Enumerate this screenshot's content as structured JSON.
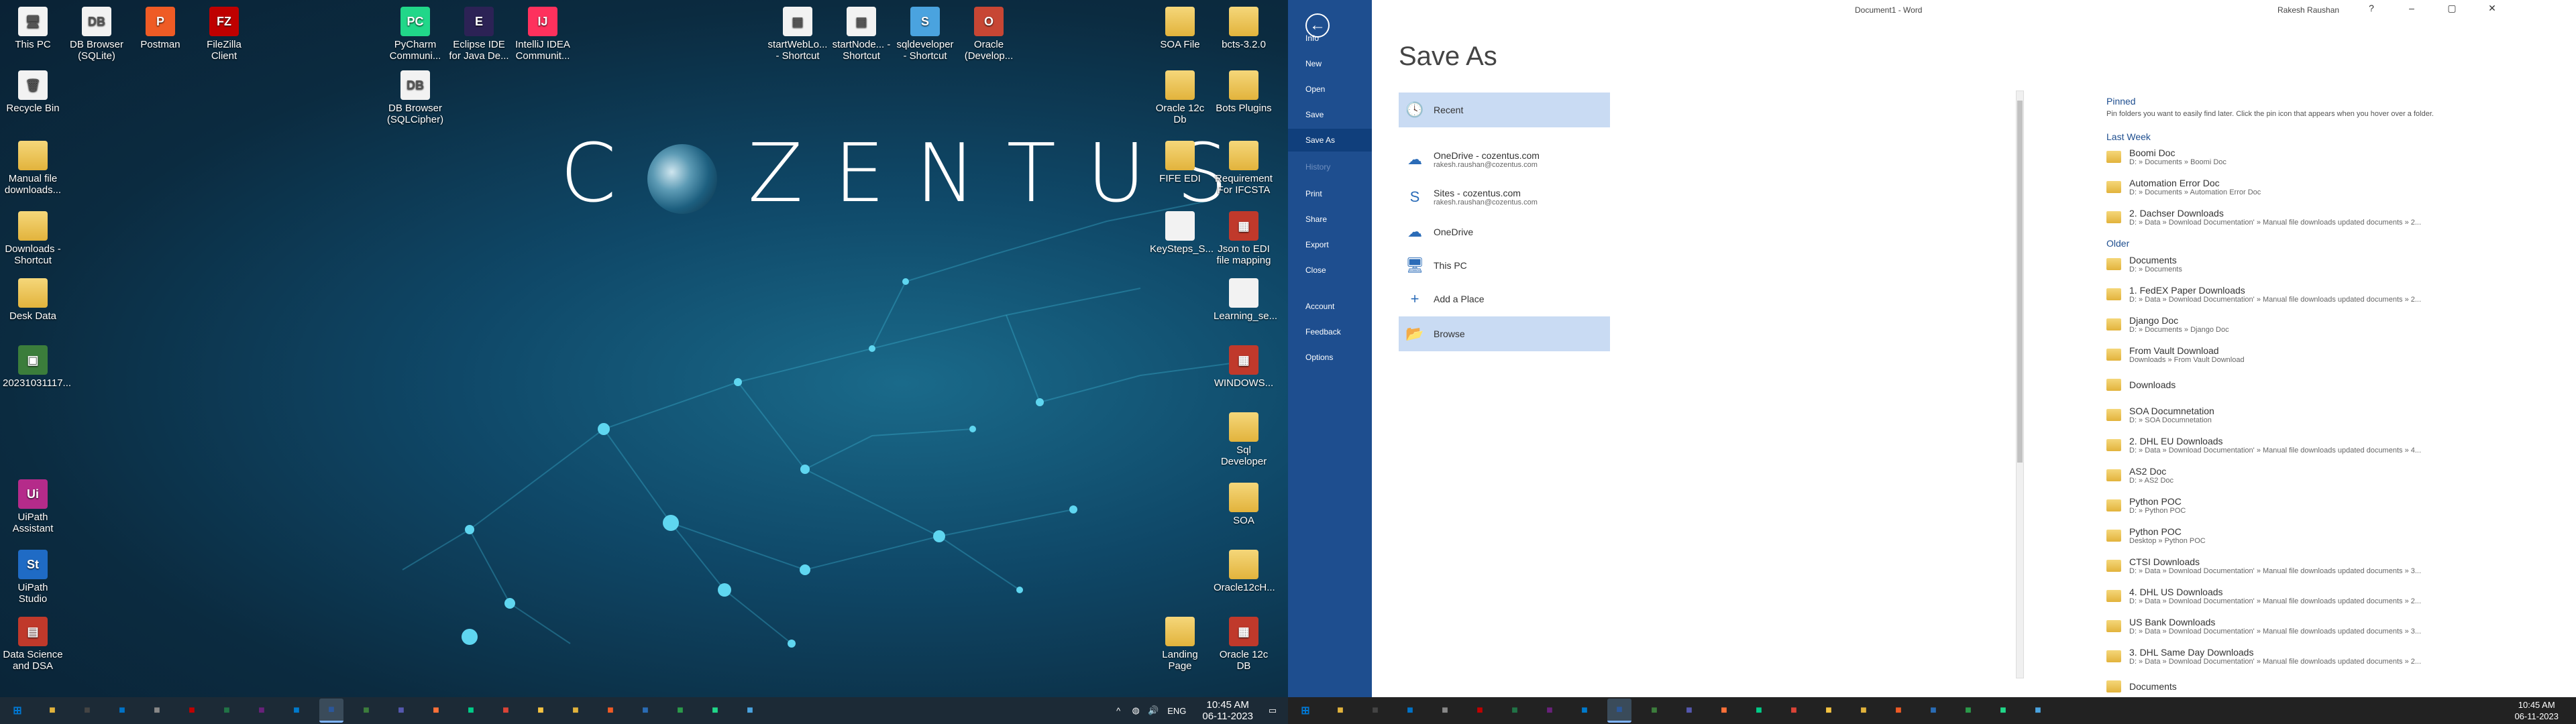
{
  "left_desktop": {
    "brand": "COZENTUS",
    "icons": [
      {
        "label": "This PC",
        "sym": "🖥",
        "cls": "doc"
      },
      {
        "label": "DB Browser (SQLite)",
        "sym": "DB",
        "cls": "doc"
      },
      {
        "label": "Postman",
        "sym": "P",
        "color": "#ef5b25"
      },
      {
        "label": "FileZilla Client",
        "sym": "FZ",
        "color": "#bf0000"
      },
      {
        "label": "PyCharm Communi...",
        "sym": "PC",
        "color": "#21d789"
      },
      {
        "label": "Eclipse IDE for Java De...",
        "sym": "E",
        "color": "#2c2255"
      },
      {
        "label": "IntelliJ IDEA Communit...",
        "sym": "IJ",
        "color": "#fe315d"
      },
      {
        "label": "startWebLo... - Shortcut",
        "sym": "▤",
        "cls": "doc"
      },
      {
        "label": "startNode... - Shortcut",
        "sym": "▤",
        "cls": "doc"
      },
      {
        "label": "sqldeveloper - Shortcut",
        "sym": "S",
        "color": "#4aa3df"
      },
      {
        "label": "Oracle (Develop...",
        "sym": "O",
        "color": "#c74634"
      },
      {
        "label": "SOA File",
        "sym": "",
        "cls": "folder"
      },
      {
        "label": "bcts-3.2.0",
        "sym": "",
        "cls": "folder"
      },
      {
        "label": "Recycle Bin",
        "sym": "🗑",
        "cls": "doc"
      },
      {
        "label": "DB Browser (SQLCipher)",
        "sym": "DB",
        "cls": "doc"
      },
      {
        "label": "Oracle 12c Db",
        "sym": "",
        "cls": "folder"
      },
      {
        "label": "Bots Plugins",
        "sym": "",
        "cls": "folder"
      },
      {
        "label": "Manual file downloads...",
        "sym": "",
        "cls": "folder"
      },
      {
        "label": "FIFE EDI",
        "sym": "",
        "cls": "folder"
      },
      {
        "label": "Requirement For IFCSTA",
        "sym": "",
        "cls": "folder"
      },
      {
        "label": "Downloads - Shortcut",
        "sym": "",
        "cls": "folder"
      },
      {
        "label": "KeySteps_S...",
        "sym": "",
        "cls": "doc"
      },
      {
        "label": "Json to EDI file mapping",
        "sym": "▦",
        "color": "#c0392b"
      },
      {
        "label": "Desk Data",
        "sym": "",
        "cls": "folder"
      },
      {
        "label": "Learning_se...",
        "sym": "",
        "cls": "doc"
      },
      {
        "label": "20231031117...",
        "sym": "▣",
        "color": "#3b7d3b"
      },
      {
        "label": "WINDOWS...",
        "sym": "▦",
        "color": "#c0392b"
      },
      {
        "label": "Sql Developer",
        "sym": "",
        "cls": "folder"
      },
      {
        "label": "SOA",
        "sym": "",
        "cls": "folder"
      },
      {
        "label": "UiPath Assistant",
        "sym": "Ui",
        "color": "#b52b8a"
      },
      {
        "label": "UiPath Studio",
        "sym": "St",
        "color": "#1f6bc5"
      },
      {
        "label": "Oracle12cH...",
        "sym": "",
        "cls": "folder"
      },
      {
        "label": "Data Science and DSA",
        "sym": "▤",
        "color": "#c0392b"
      },
      {
        "label": "Landing Page",
        "sym": "",
        "cls": "folder"
      },
      {
        "label": "Oracle 12c DB",
        "sym": "▦",
        "color": "#c0392b"
      }
    ]
  },
  "taskbar_left": {
    "icons": [
      "start-icon",
      "folder-icon",
      "notion-icon",
      "mail-icon",
      "files-icon",
      "filezilla-icon",
      "excel-icon",
      "vs-icon",
      "vscode-icon",
      "word-icon",
      "notepad-icon",
      "teams-icon",
      "firefox-icon",
      "edge-icon",
      "chrome-icon",
      "explorer-icon",
      "folder-icon",
      "postman-icon",
      "sql-icon",
      "app-icon",
      "pycharm-icon",
      "sql-developer-icon"
    ],
    "time": "10:45 AM",
    "date": "06-11-2023",
    "lang": "ENG"
  },
  "taskbar_right": {
    "time": "10:45 AM",
    "date": "06-11-2023"
  },
  "word": {
    "title": "Document1 - Word",
    "user": "Rakesh Raushan",
    "page_title": "Save As",
    "nav": [
      "Info",
      "New",
      "Open",
      "Save",
      "Save As",
      "History",
      "Print",
      "Share",
      "Export",
      "Close",
      "Account",
      "Feedback",
      "Options"
    ],
    "places": [
      {
        "t1": "Recent",
        "t2": "",
        "icon": "clock-icon",
        "sym": "🕓",
        "sel": true
      },
      {
        "t1": "OneDrive - cozentus.com",
        "t2": "rakesh.raushan@cozentus.com",
        "icon": "onedrive-icon",
        "sym": "☁"
      },
      {
        "t1": "Sites - cozentus.com",
        "t2": "rakesh.raushan@cozentus.com",
        "icon": "sharepoint-icon",
        "sym": "S"
      },
      {
        "t1": "OneDrive",
        "t2": "",
        "icon": "onedrive-icon",
        "sym": "☁"
      },
      {
        "t1": "This PC",
        "t2": "",
        "icon": "pc-icon",
        "sym": "🖥"
      },
      {
        "t1": "Add a Place",
        "t2": "",
        "icon": "plus-icon",
        "sym": "+"
      },
      {
        "t1": "Browse",
        "t2": "",
        "icon": "browse-folder-icon",
        "sym": "📂",
        "sel": true
      }
    ],
    "pinned_label": "Pinned",
    "pinned_note": "Pin folders you want to easily find later. Click the pin icon that appears when you hover over a folder.",
    "last_week_label": "Last Week",
    "older_label": "Older",
    "last_week": [
      {
        "name": "Boomi Doc",
        "path": "D: » Documents » Boomi Doc"
      },
      {
        "name": "Automation Error Doc",
        "path": "D: » Documents » Automation Error Doc"
      },
      {
        "name": "2. Dachser Downloads",
        "path": "D: » Data » Download Documentation' » Manual file downloads updated documents » 2..."
      }
    ],
    "older": [
      {
        "name": "Documents",
        "path": "D: » Documents"
      },
      {
        "name": "1. FedEX Paper Downloads",
        "path": "D: » Data » Download Documentation' » Manual file downloads updated documents » 2..."
      },
      {
        "name": "Django Doc",
        "path": "D: » Documents » Django Doc"
      },
      {
        "name": "From Vault Download",
        "path": "Downloads » From Vault Download"
      },
      {
        "name": "Downloads",
        "path": ""
      },
      {
        "name": "SOA Documnetation",
        "path": "D: » SOA Documnetation"
      },
      {
        "name": "2. DHL EU Downloads",
        "path": "D: » Data » Download Documentation' » Manual file downloads updated documents » 4..."
      },
      {
        "name": "AS2 Doc",
        "path": "D: » AS2 Doc"
      },
      {
        "name": "Python POC",
        "path": "D: » Python POC"
      },
      {
        "name": "Python POC",
        "path": "Desktop » Python POC"
      },
      {
        "name": "CTSI Downloads",
        "path": "D: » Data » Download Documentation' » Manual file downloads updated documents » 3..."
      },
      {
        "name": "4. DHL US Downloads",
        "path": "D: » Data » Download Documentation' » Manual file downloads updated documents » 2..."
      },
      {
        "name": "US Bank Downloads",
        "path": "D: » Data » Download Documentation' » Manual file downloads updated documents » 3..."
      },
      {
        "name": "3. DHL Same Day Downloads",
        "path": "D: » Data » Download Documentation' » Manual file downloads updated documents » 2..."
      },
      {
        "name": "Documents",
        "path": ""
      }
    ]
  }
}
